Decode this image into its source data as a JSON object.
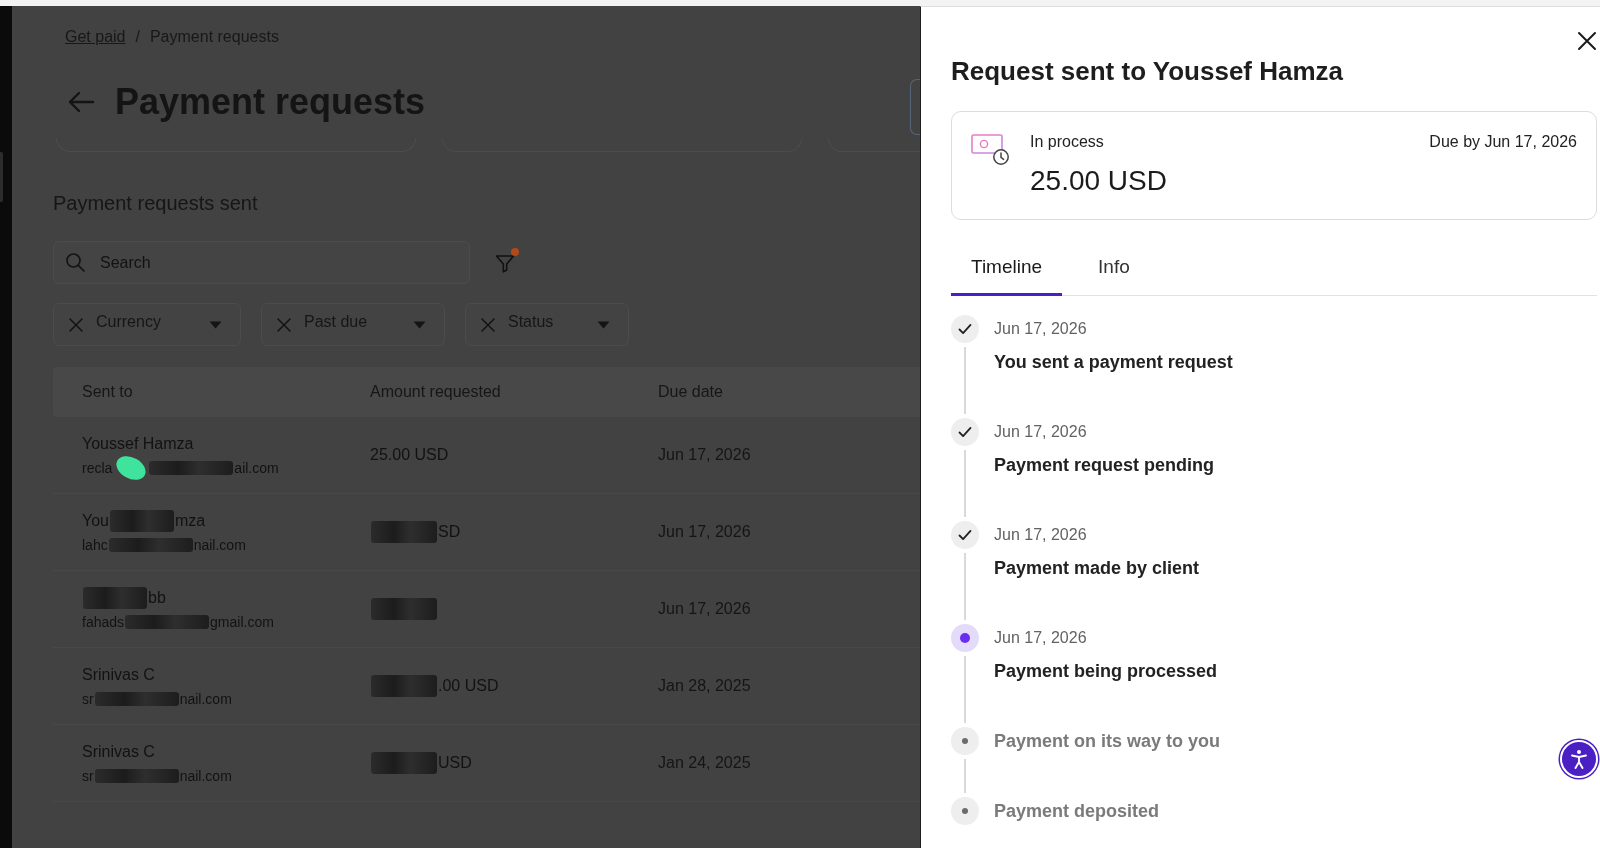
{
  "breadcrumb": {
    "items": [
      {
        "kind": "link",
        "label": "Get paid"
      },
      {
        "kind": "current",
        "label": "Payment requests"
      }
    ],
    "separator": "/"
  },
  "page_title": "Payment requests",
  "section_title": "Payment requests sent",
  "search": {
    "placeholder": "Search"
  },
  "filter": {
    "active": true
  },
  "filter_chips": [
    {
      "label": "Currency"
    },
    {
      "label": "Past due"
    },
    {
      "label": "Status"
    }
  ],
  "table": {
    "columns": [
      "Sent to",
      "Amount requested",
      "Due date"
    ],
    "rows": [
      {
        "name": [
          {
            "kind": "text",
            "text": "Youssef Hamza"
          }
        ],
        "email": [
          {
            "kind": "text",
            "text": "recla"
          },
          {
            "kind": "marker"
          },
          {
            "kind": "redaction"
          },
          {
            "kind": "text",
            "text": "ail.com"
          }
        ],
        "amount": [
          {
            "kind": "text",
            "text": "25.00 USD"
          }
        ],
        "due_date": "Jun 17, 2026"
      },
      {
        "name": [
          {
            "kind": "text",
            "text": "You"
          },
          {
            "kind": "redaction"
          },
          {
            "kind": "text",
            "text": "mza"
          }
        ],
        "email": [
          {
            "kind": "text",
            "text": "lahc"
          },
          {
            "kind": "redaction"
          },
          {
            "kind": "text",
            "text": "nail.com"
          }
        ],
        "amount": [
          {
            "kind": "redaction"
          },
          {
            "kind": "text",
            "text": "SD"
          }
        ],
        "due_date": "Jun 17, 2026"
      },
      {
        "name": [
          {
            "kind": "redaction"
          },
          {
            "kind": "text",
            "text": "bb"
          }
        ],
        "email": [
          {
            "kind": "text",
            "text": "fahads"
          },
          {
            "kind": "redaction"
          },
          {
            "kind": "text",
            "text": "gmail.com"
          }
        ],
        "amount": [
          {
            "kind": "redaction"
          }
        ],
        "due_date": "Jun 17, 2026"
      },
      {
        "name": [
          {
            "kind": "text",
            "text": "Srinivas C"
          }
        ],
        "email": [
          {
            "kind": "text",
            "text": "sr"
          },
          {
            "kind": "redaction"
          },
          {
            "kind": "text",
            "text": "nail.com"
          }
        ],
        "amount": [
          {
            "kind": "redaction"
          },
          {
            "kind": "text",
            "text": ".00 USD"
          }
        ],
        "due_date": "Jan 28, 2025"
      },
      {
        "name": [
          {
            "kind": "text",
            "text": "Srinivas C"
          }
        ],
        "email": [
          {
            "kind": "text",
            "text": "sr"
          },
          {
            "kind": "redaction"
          },
          {
            "kind": "text",
            "text": "nail.com"
          }
        ],
        "amount": [
          {
            "kind": "redaction"
          },
          {
            "kind": "text",
            "text": "USD"
          }
        ],
        "due_date": "Jan 24, 2025"
      }
    ]
  },
  "panel": {
    "title": "Request sent to Youssef Hamza",
    "summary": {
      "status": "In process",
      "amount": "25.00 USD",
      "due": "Due by Jun 17, 2026"
    },
    "tabs": [
      {
        "label": "Timeline",
        "selected": true
      },
      {
        "label": "Info",
        "selected": false
      }
    ],
    "timeline": [
      {
        "kind": "done",
        "date": "Jun 17, 2026",
        "title": "You sent a payment request"
      },
      {
        "kind": "done",
        "date": "Jun 17, 2026",
        "title": "Payment request pending"
      },
      {
        "kind": "done",
        "date": "Jun 17, 2026",
        "title": "Payment made by client"
      },
      {
        "kind": "current",
        "date": "Jun 17, 2026",
        "title": "Payment being processed"
      },
      {
        "kind": "pending",
        "title": "Payment on its way to you"
      },
      {
        "kind": "pending",
        "title": "Payment deposited"
      }
    ]
  }
}
